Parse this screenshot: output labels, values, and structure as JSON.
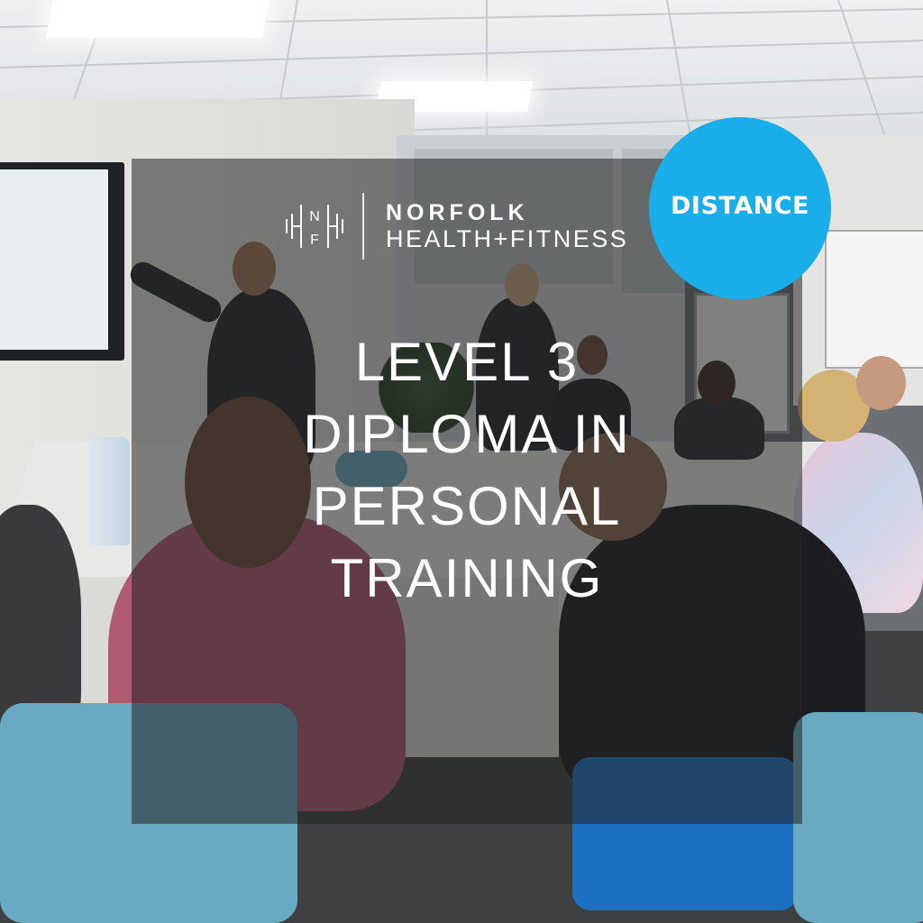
{
  "badge": {
    "label": "DISTANCE",
    "color": "#19aee9"
  },
  "logo": {
    "monogram": [
      "N",
      "F"
    ],
    "line1": "NORFOLK",
    "line2": "HEALTH+FITNESS"
  },
  "headline": {
    "lines": [
      "LEVEL 3",
      "DIPLOMA IN",
      "PERSONAL",
      "TRAINING"
    ]
  },
  "overlay_color": "rgba(35,35,35,0.55)"
}
